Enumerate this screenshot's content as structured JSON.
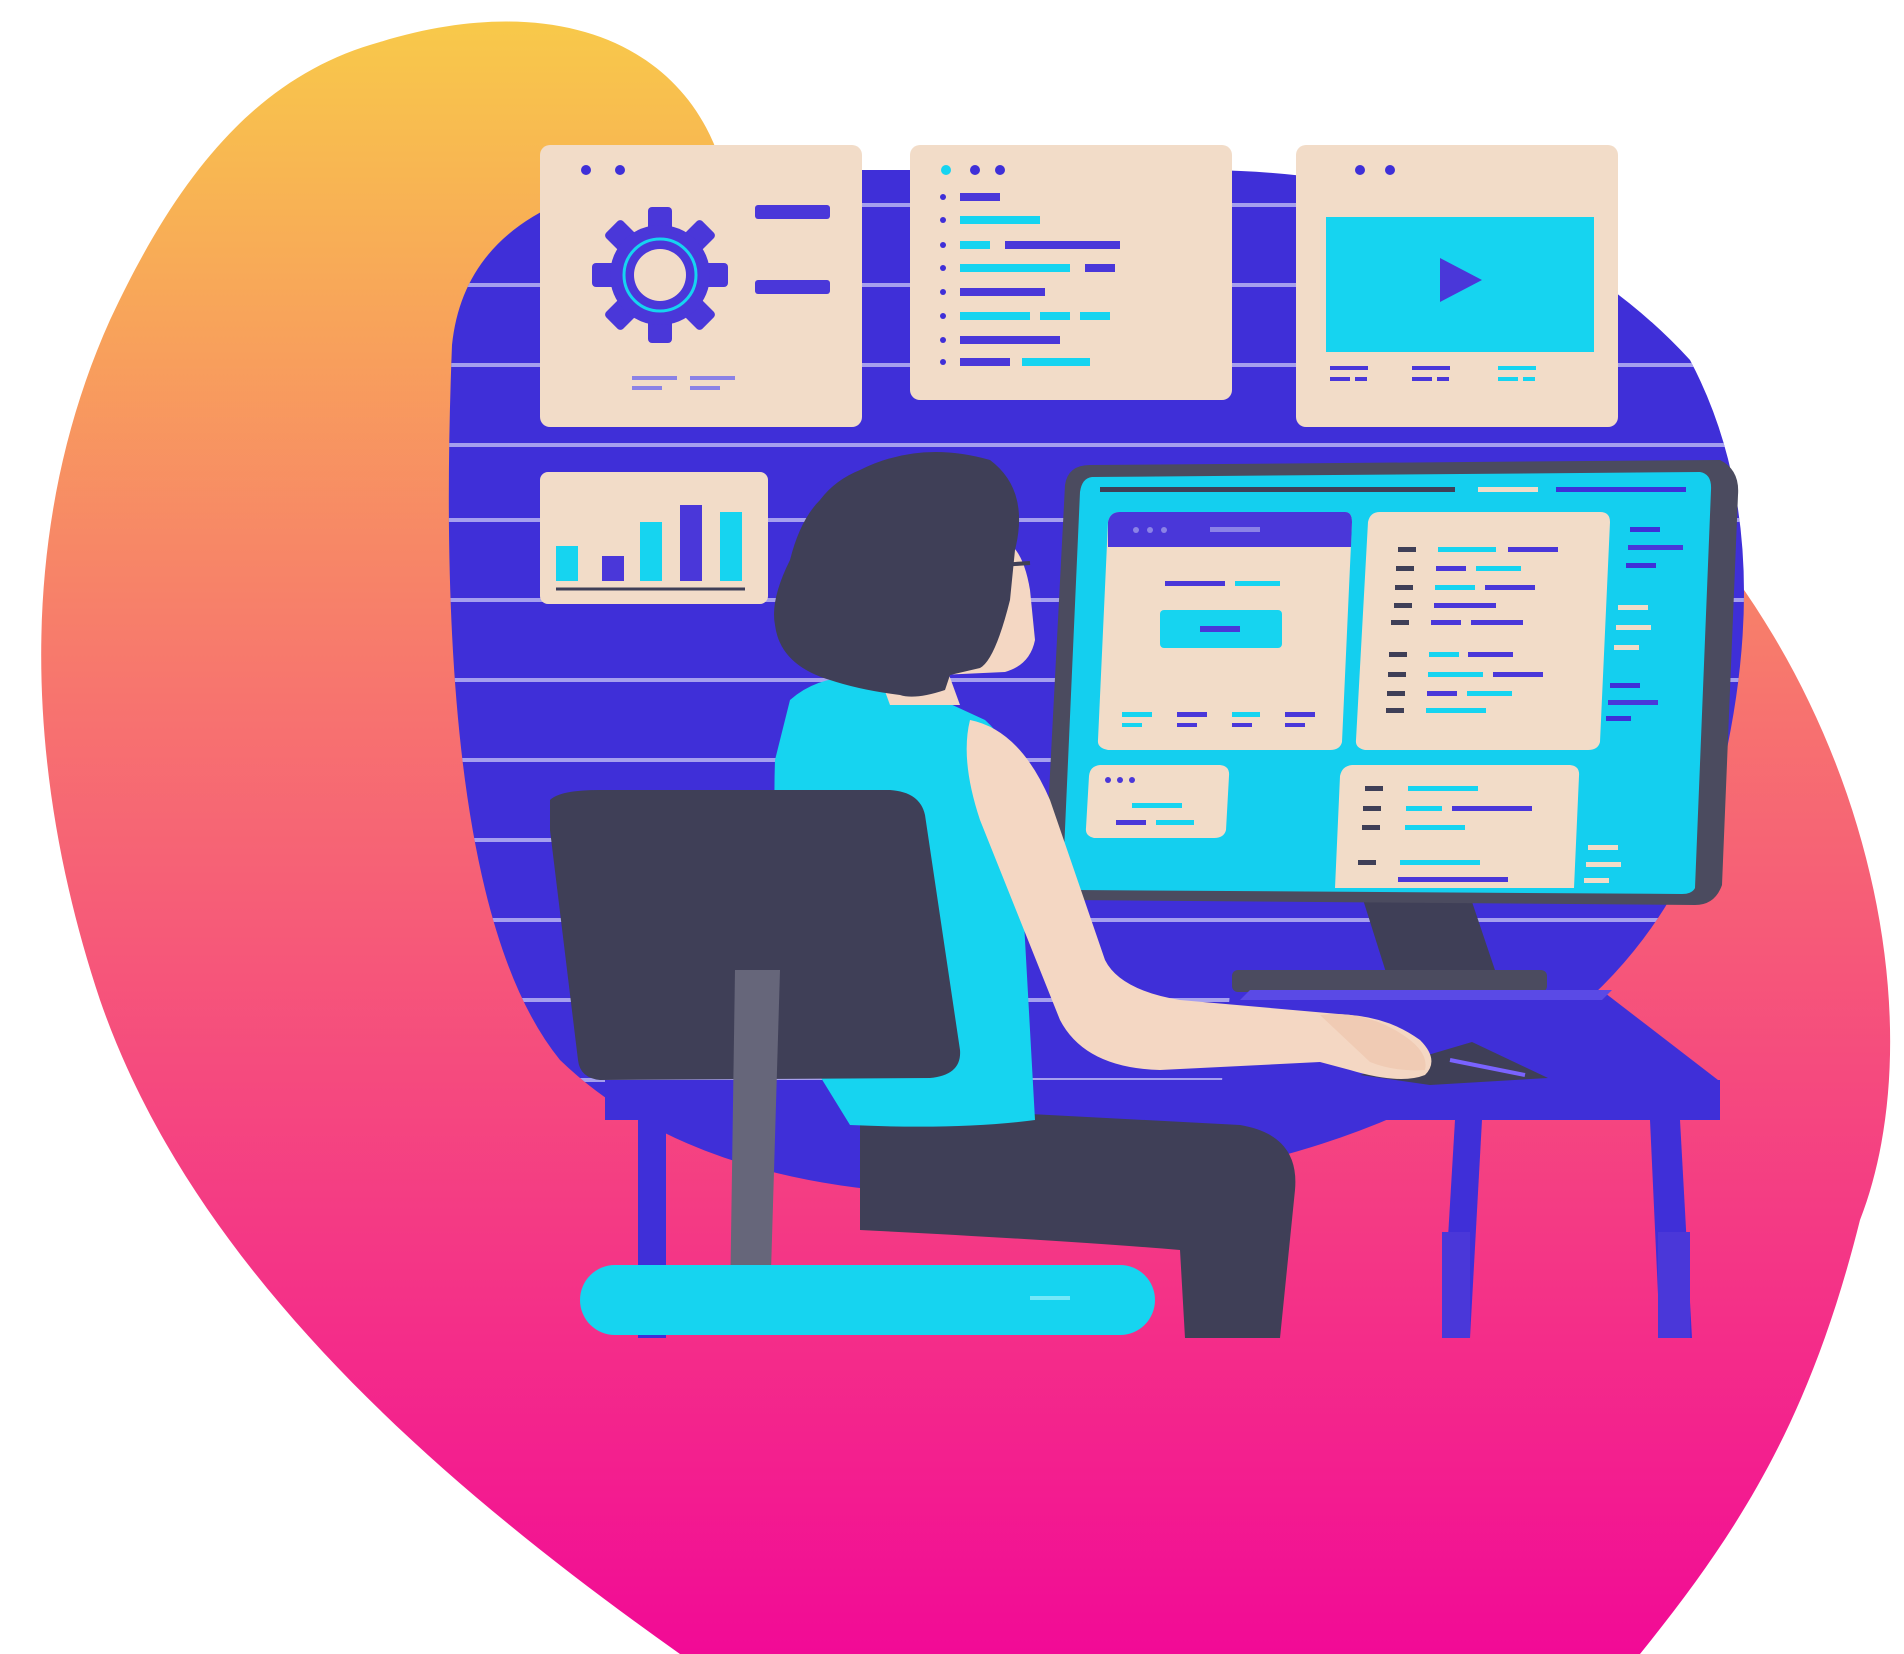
{
  "illustration": {
    "subject": "person-working-at-computer",
    "icons": [
      "gear-icon",
      "play-icon",
      "bar-chart-icon"
    ],
    "colors": {
      "blob_top": "#f8c94a",
      "blob_mid": "#f7736f",
      "blob_bottom": "#f20a96",
      "wall_circle": "#3f2fd8",
      "panel": "#f2dcc8",
      "accent_cyan": "#16d4f0",
      "accent_indigo": "#4a37d9",
      "dark": "#3f3f57",
      "skin": "#f4d7c3",
      "monitor_frame": "#4b4b5f",
      "screen_blue": "#14cfef",
      "desk": "#3f2fd8"
    }
  }
}
